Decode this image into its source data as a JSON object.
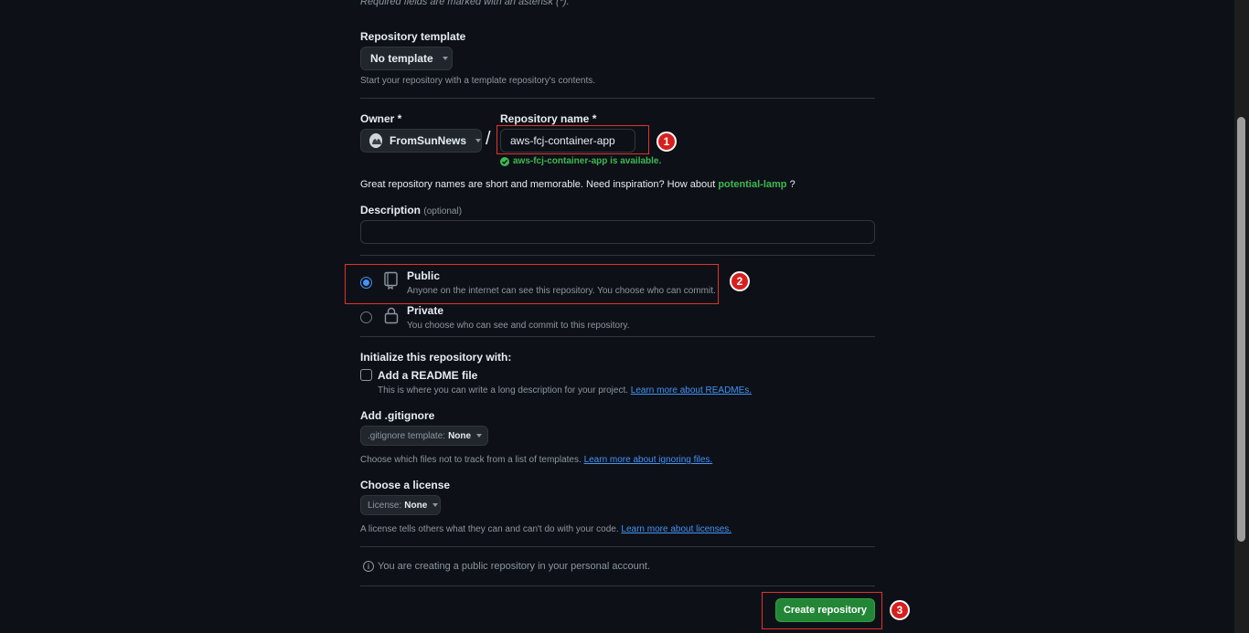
{
  "top_note": "Required fields are marked with an asterisk (*).",
  "template": {
    "label": "Repository template",
    "button": "No template",
    "help": "Start your repository with a template repository's contents."
  },
  "owner": {
    "label": "Owner *",
    "value": "FromSunNews"
  },
  "slash": "/",
  "repo_name": {
    "label": "Repository name *",
    "value": "aws-fcj-container-app",
    "available": "aws-fcj-container-app is available."
  },
  "inspiration": {
    "text": "Great repository names are short and memorable. Need inspiration? How about",
    "suggestion": "potential-lamp",
    "end": "?"
  },
  "description": {
    "label": "Description",
    "optional": "(optional)",
    "value": ""
  },
  "visibility": {
    "public": {
      "title": "Public",
      "desc": "Anyone on the internet can see this repository. You choose who can commit."
    },
    "private": {
      "title": "Private",
      "desc": "You choose who can see and commit to this repository."
    },
    "selected": "Public"
  },
  "init": {
    "heading": "Initialize this repository with:",
    "readme_label": "Add a README file",
    "readme_help": "This is where you can write a long description for your project.",
    "readme_link": "Learn more about READMEs.",
    "readme_checked": false
  },
  "gitignore": {
    "label": "Add .gitignore",
    "button_prefix": ".gitignore template:",
    "button_value": "None",
    "help": "Choose which files not to track from a list of templates.",
    "link": "Learn more about ignoring files."
  },
  "license": {
    "label": "Choose a license",
    "button_prefix": "License:",
    "button_value": "None",
    "help": "A license tells others what they can and can't do with your code.",
    "link": "Learn more about licenses."
  },
  "notice": "You are creating a public repository in your personal account.",
  "create_button": "Create repository",
  "annotations": {
    "one": "1",
    "two": "2",
    "three": "3"
  },
  "colors": {
    "background": "#0d1117",
    "accent_blue": "#4493f8",
    "success_green": "#3fb950",
    "primary_button": "#238636",
    "annotation_red": "#e5302c"
  }
}
